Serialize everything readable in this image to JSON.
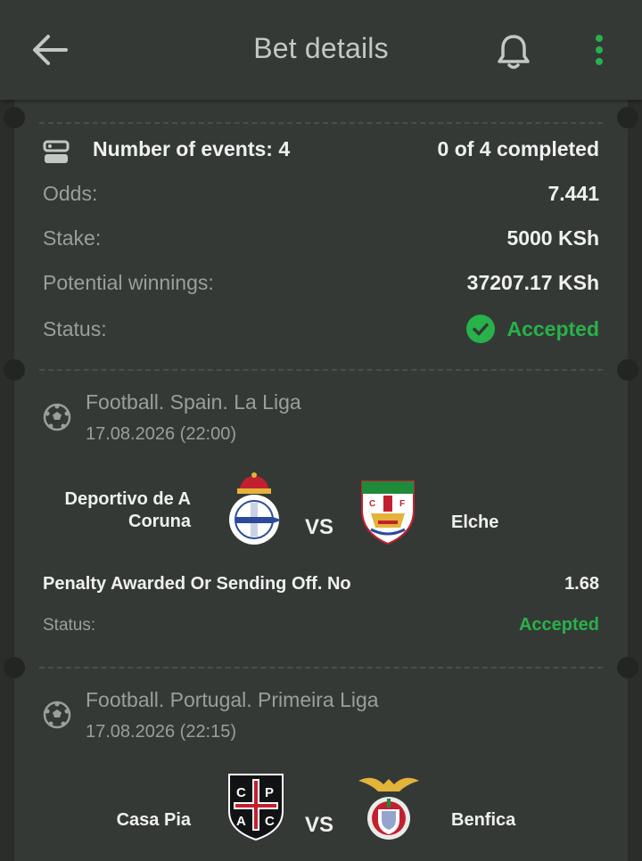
{
  "header": {
    "title": "Bet details",
    "icons": {
      "back": "arrow-left-icon",
      "notifications": "bell-icon",
      "menu": "kebab-menu-icon"
    }
  },
  "summary": {
    "events_label": "Number of events: 4",
    "completed": "0 of 4 completed",
    "odds_label": "Odds:",
    "odds_value": "7.441",
    "stake_label": "Stake:",
    "stake_value": "5000 KSh",
    "winnings_label": "Potential winnings:",
    "winnings_value": "37207.17 KSh",
    "status_label": "Status:",
    "status_value": "Accepted"
  },
  "events": [
    {
      "league": "Football. Spain. La Liga",
      "datetime": "17.08.2026 (22:00)",
      "home": "Deportivo de A Coruna",
      "away": "Elche",
      "vs": "VS",
      "market": "Penalty Awarded Or Sending Off. No",
      "coefficient": "1.68",
      "status_label": "Status:",
      "status_value": "Accepted"
    },
    {
      "league": "Football. Portugal. Primeira Liga",
      "datetime": "17.08.2026 (22:15)",
      "home": "Casa Pia",
      "away": "Benfica",
      "vs": "VS"
    }
  ],
  "colors": {
    "accent_green": "#27b24a",
    "background": "#2a2d2a",
    "card": "#353936",
    "muted_text": "#9a9f9b"
  }
}
